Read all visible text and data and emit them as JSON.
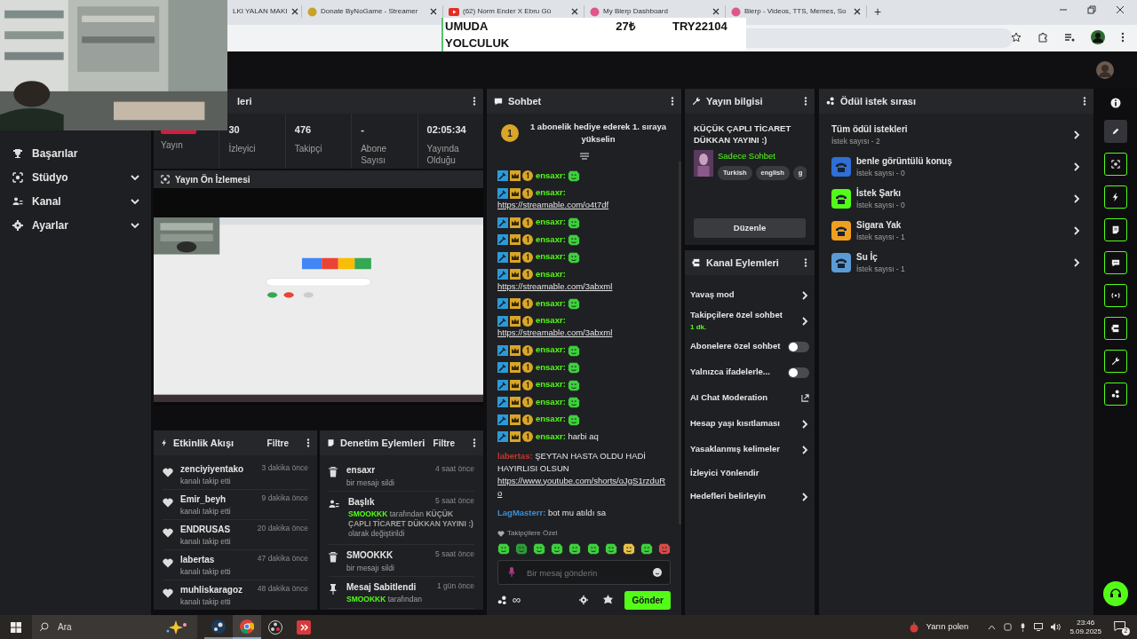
{
  "browser": {
    "tabs": [
      {
        "title": "LKI YALAN MAKI"
      },
      {
        "title": "Donate ByNoGame - Streamer"
      },
      {
        "title": "(62) Norm Ender X Ebru Gü"
      },
      {
        "title": "My Blerp Dashboard"
      },
      {
        "title": "Blerp - Videos, TTS, Memes, So"
      }
    ],
    "new_tab": "+"
  },
  "stream_overlay": {
    "goal": "UMUDA YOLCULUK",
    "amount": "27₺",
    "total": "TRY22104"
  },
  "sidebar": {
    "items": [
      {
        "label": "Başarılar",
        "expandable": false
      },
      {
        "label": "Stüdyo",
        "expandable": true
      },
      {
        "label": "Kanal",
        "expandable": true
      },
      {
        "label": "Ayarlar",
        "expandable": true
      }
    ]
  },
  "stats": {
    "title": "leri",
    "cells": [
      {
        "kind": "badge",
        "label": "Yayın"
      },
      {
        "kind": "number",
        "value": "30",
        "label": "İzleyici"
      },
      {
        "kind": "number",
        "value": "476",
        "label": "Takipçi"
      },
      {
        "kind": "number",
        "value": "-",
        "label": "Abone Sayısı"
      },
      {
        "kind": "number",
        "value": "02:05:34",
        "label": "Yayında Olduğu"
      }
    ]
  },
  "preview": {
    "title": "Yayın Ön İzlemesi"
  },
  "activity": {
    "title": "Etkinlik Akışı",
    "filter": "Filtre",
    "items": [
      {
        "user": "zenciyiyentako",
        "action": "kanalı takip etti",
        "time": "3 dakika önce"
      },
      {
        "user": "Emir_beyh",
        "action": "kanalı takip etti",
        "time": "9 dakika önce"
      },
      {
        "user": "ENDRUSAS",
        "action": "kanalı takip etti",
        "time": "20 dakika önce"
      },
      {
        "user": "labertas",
        "action": "kanalı takip etti",
        "time": "47 dakika önce"
      },
      {
        "user": "muhliskaragoz",
        "action": "kanalı takip etti",
        "time": "48 dakika önce"
      }
    ]
  },
  "moderation": {
    "title": "Denetim Eylemleri",
    "filter": "Filtre",
    "items": [
      {
        "kind": "delete",
        "title": "ensaxr",
        "time": "4 saat önce",
        "text": "bir mesajı sildi"
      },
      {
        "kind": "title",
        "title": "Başlık",
        "time": "5 saat önce",
        "actor": "SMOOKKK",
        "text": "tarafından **KÜÇÜK ÇAPLI TİCARET DÜKKAN YAYINI :)** olarak değiştirildi"
      },
      {
        "kind": "delete",
        "title": "SMOOKKK",
        "time": "5 saat önce",
        "text": "bir mesajı sildi"
      },
      {
        "kind": "pin",
        "title": "Mesaj Sabitlendi",
        "time": "1 gün önce",
        "actor": "SMOOKKK",
        "text": "tarafından"
      }
    ]
  },
  "chat": {
    "title": "Sohbet",
    "banner": {
      "rank": "1",
      "text": "1 abonelik hediye ederek 1. sıraya yükselin"
    },
    "messages": [
      {
        "kind": "emote",
        "user": "ensaxr:",
        "color": "#53fc18",
        "badges": true
      },
      {
        "kind": "link",
        "user": "ensaxr:",
        "color": "#53fc18",
        "badges": true,
        "link": "https://streamable.com/o4t7df"
      },
      {
        "kind": "emote",
        "user": "ensaxr:",
        "color": "#53fc18",
        "badges": true
      },
      {
        "kind": "emote",
        "user": "ensaxr:",
        "color": "#53fc18",
        "badges": true
      },
      {
        "kind": "emote",
        "user": "ensaxr:",
        "color": "#53fc18",
        "badges": true
      },
      {
        "kind": "link",
        "user": "ensaxr:",
        "color": "#53fc18",
        "badges": true,
        "link": "https://streamable.com/3abxml"
      },
      {
        "kind": "emote",
        "user": "ensaxr:",
        "color": "#53fc18",
        "badges": true
      },
      {
        "kind": "link",
        "user": "ensaxr:",
        "color": "#53fc18",
        "badges": true,
        "link": "https://streamable.com/3abxml"
      },
      {
        "kind": "emote",
        "user": "ensaxr:",
        "color": "#53fc18",
        "badges": true
      },
      {
        "kind": "emote",
        "user": "ensaxr:",
        "color": "#53fc18",
        "badges": true
      },
      {
        "kind": "emote",
        "user": "ensaxr:",
        "color": "#53fc18",
        "badges": true
      },
      {
        "kind": "emote",
        "user": "ensaxr:",
        "color": "#53fc18",
        "badges": true
      },
      {
        "kind": "emote",
        "user": "ensaxr:",
        "color": "#53fc18",
        "badges": true
      },
      {
        "kind": "text",
        "user": "ensaxr:",
        "color": "#53fc18",
        "badges": true,
        "text": "harbi aq"
      },
      {
        "kind": "text",
        "user": "labertas:",
        "color": "#c0392b",
        "badges": false,
        "text": "ŞEYTAN HASTA OLDU HADİ HAYIRLISI OLSUN",
        "link": "https://www.youtube.com/shorts/oJgS1rzduRo"
      },
      {
        "kind": "text",
        "user": "LagMasterr:",
        "color": "#3b8fd6",
        "badges": false,
        "text": "bot mu atıldı sa"
      }
    ],
    "emote_bar": {
      "title": "Takipçilere Özel"
    },
    "input": {
      "placeholder": "Bir mesaj gönderin"
    },
    "points": "∞",
    "send": "Gönder"
  },
  "stream_info": {
    "title": "Yayın bilgisi",
    "stream_title": "KÜÇÜK ÇAPLI TİCARET DÜKKAN YAYINI :)",
    "category": "Sadece Sohbet",
    "tags": [
      "Turkish",
      "english",
      "g"
    ],
    "edit": "Düzenle"
  },
  "channel_actions": {
    "title": "Kanal Eylemleri",
    "items": [
      {
        "kind": "chevron",
        "label": "Yavaş mod"
      },
      {
        "kind": "chevron",
        "label": "Takipçilere özel sohbet",
        "sub": "1 dk."
      },
      {
        "kind": "toggle",
        "label": "Abonelere özel sohbet",
        "on": false
      },
      {
        "kind": "toggle",
        "label": "Yalnızca ifadelerle...",
        "on": false
      },
      {
        "kind": "external",
        "label": "AI Chat Moderation"
      },
      {
        "kind": "chevron",
        "label": "Hesap yaşı kısıtlaması"
      },
      {
        "kind": "chevron",
        "label": "Yasaklanmış kelimeler"
      },
      {
        "kind": "plain",
        "label": "İzleyici Yönlendir"
      },
      {
        "kind": "chevron",
        "label": "Hedefleri belirleyin"
      }
    ]
  },
  "rewards": {
    "title": "Ödül istek sırası",
    "all": {
      "label": "Tüm ödül istekleri",
      "count": "İstek sayısı - 2"
    },
    "items": [
      {
        "label": "benle görüntülü konuş",
        "count": "İstek sayısı - 0",
        "color": "#2f6fd6"
      },
      {
        "label": "İstek Şarkı",
        "count": "İstek sayısı - 0",
        "color": "#53fc18"
      },
      {
        "label": "Sigara Yak",
        "count": "İstek sayısı - 1",
        "color": "#f0a020"
      },
      {
        "label": "Su İç",
        "count": "İstek sayısı - 1",
        "color": "#5b9bd5"
      }
    ]
  },
  "rail": {
    "items": [
      {
        "selected": true
      },
      {
        "selected": false
      },
      {
        "selected": false
      },
      {
        "selected": false
      },
      {
        "selected": false
      },
      {
        "selected": false
      },
      {
        "selected": false
      },
      {
        "selected": false
      },
      {
        "selected": false
      }
    ]
  },
  "taskbar": {
    "search": "Ara",
    "weather": "Yarın polen",
    "time": "23:46",
    "date": "5.09.2025",
    "notifications": "2"
  }
}
